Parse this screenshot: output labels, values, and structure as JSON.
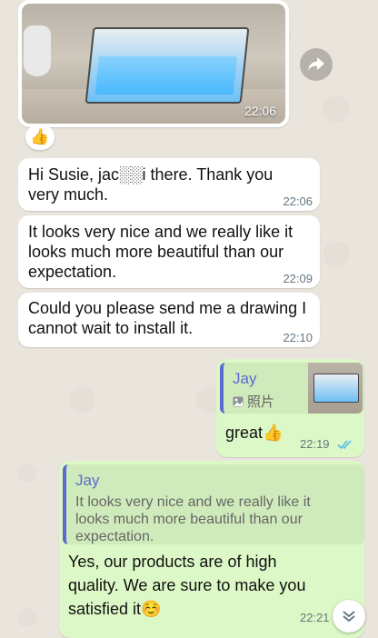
{
  "image_message": {
    "time": "22:06"
  },
  "reaction": {
    "emoji": "👍"
  },
  "incoming": [
    {
      "text": "Hi Susie, jac░░i there. Thank you very much.",
      "time": "22:06"
    },
    {
      "text": "It looks very nice and we really like it looks much more beautiful than our expectation.",
      "time": "22:09"
    },
    {
      "text": "Could you please send me a drawing I cannot wait to install it.",
      "time": "22:10"
    }
  ],
  "outgoing_1": {
    "quote_author": "Jay",
    "quote_label": "照片",
    "text": "great👍",
    "time": "22:19"
  },
  "outgoing_2": {
    "quote_author": "Jay",
    "quote_text": "It looks very nice and we really like it looks much more beautiful than our expectation.",
    "text": "Yes, our products are of high quality. We are sure to make you satisfied it☺️",
    "time": "22:21"
  },
  "colors": {
    "incoming_bubble": "#ffffff",
    "outgoing_bubble": "#dcf8c6",
    "quote_accent": "#5b6ad0",
    "read_ticks": "#53bdeb"
  },
  "icons": {
    "forward": "forward-icon",
    "photo": "photo-icon",
    "read": "double-check-icon",
    "scroll": "chevron-double-down-icon"
  }
}
